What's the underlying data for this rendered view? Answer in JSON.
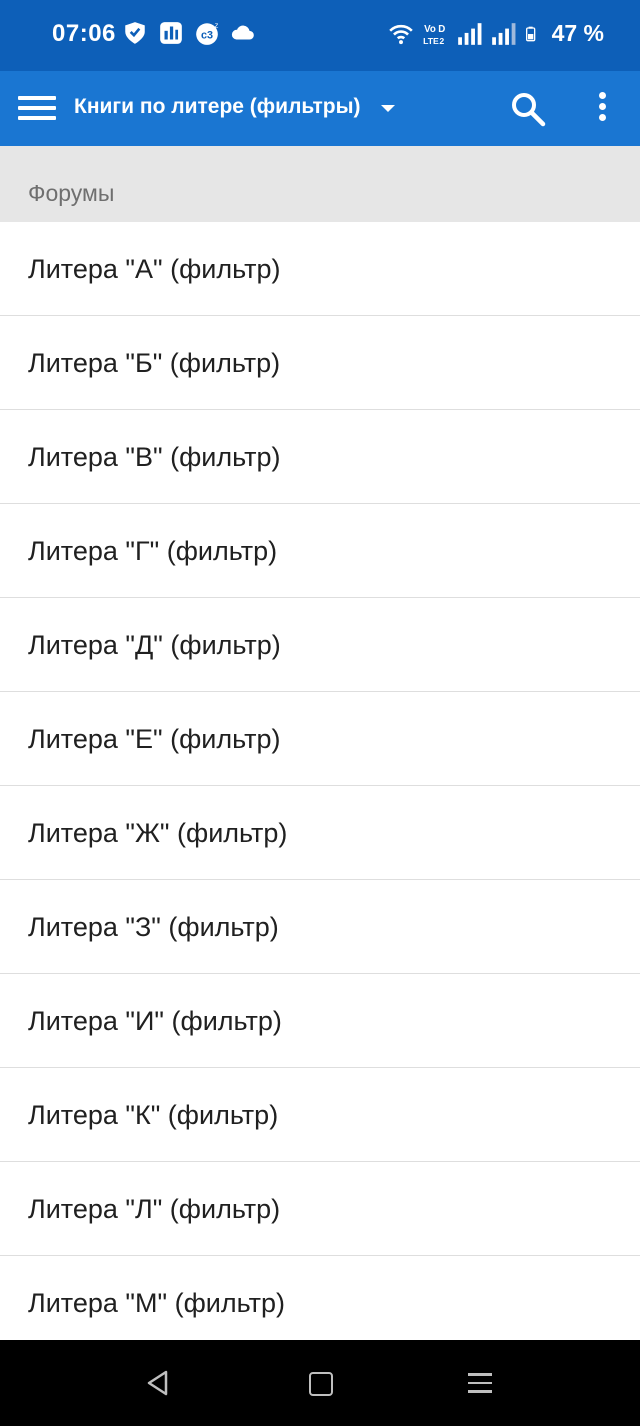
{
  "status_bar": {
    "time": "07:06",
    "battery": "47 %",
    "icons_left": [
      "shield-icon",
      "music-app-icon",
      "calendar-app-icon",
      "cloud-icon"
    ],
    "icons_right": [
      "wifi-icon",
      "volte-icon",
      "signal-icon",
      "signal-icon",
      "battery-icon"
    ]
  },
  "app_bar": {
    "title": "Книги по литере (фильтры)",
    "bg_color": "#1a76d2"
  },
  "section": {
    "title": "Форумы"
  },
  "list": {
    "items": [
      {
        "label": "Литера \"А\" (фильтр)"
      },
      {
        "label": "Литера \"Б\" (фильтр)"
      },
      {
        "label": "Литера \"В\" (фильтр)"
      },
      {
        "label": "Литера \"Г\" (фильтр)"
      },
      {
        "label": "Литера \"Д\" (фильтр)"
      },
      {
        "label": "Литера \"Е\" (фильтр)"
      },
      {
        "label": "Литера \"Ж\" (фильтр)"
      },
      {
        "label": "Литера \"З\" (фильтр)"
      },
      {
        "label": "Литера \"И\" (фильтр)"
      },
      {
        "label": "Литера \"К\" (фильтр)"
      },
      {
        "label": "Литера \"Л\" (фильтр)"
      },
      {
        "label": "Литера \"М\" (фильтр)"
      }
    ]
  }
}
